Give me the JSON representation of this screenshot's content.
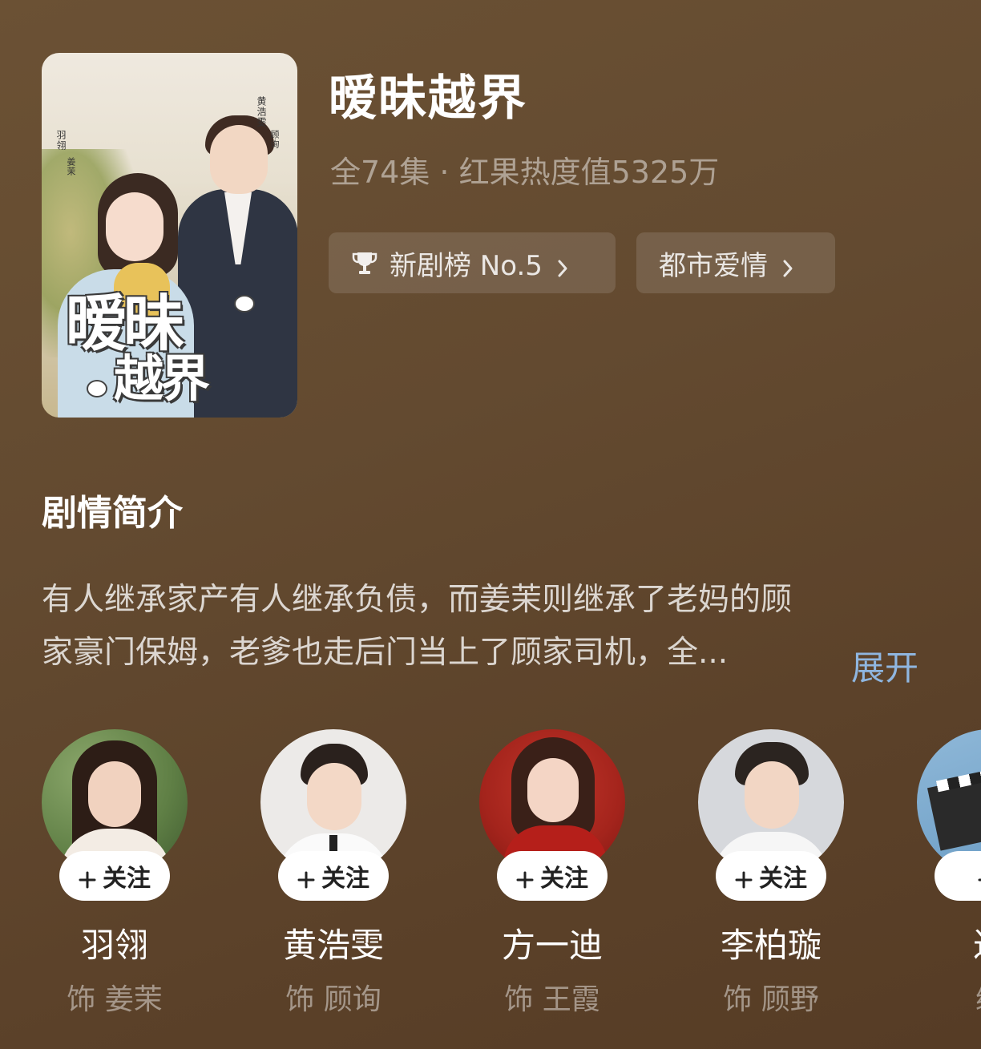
{
  "poster": {
    "title_line1": "暧昧",
    "title_line2": "越界",
    "credit_right_name": "黄浩雯",
    "credit_right_role": "顾询",
    "credit_left_name": "羽翎",
    "credit_left_role": "姜茉"
  },
  "show": {
    "title": "暧昧越界",
    "meta": "全74集 · 红果热度值5325万",
    "rank_tag": "新剧榜 No.5",
    "genre_tag": "都市爱情"
  },
  "synopsis": {
    "heading": "剧情简介",
    "line1": "有人继承家产有人继承负债，而姜茉则继承了老妈的顾",
    "line2": "家豪门保姆，老爹也走后门当上了顾家司机，全...",
    "expand_label": "展开"
  },
  "cast": [
    {
      "name": "羽翎",
      "role": "饰 姜茉",
      "follow_label": "关注"
    },
    {
      "name": "黄浩雯",
      "role": "饰 顾询",
      "follow_label": "关注"
    },
    {
      "name": "方一迪",
      "role": "饰 王霞",
      "follow_label": "关注"
    },
    {
      "name": "李柏璇",
      "role": "饰 顾野",
      "follow_label": "关注"
    },
    {
      "name": "过",
      "role": "编"
    }
  ],
  "colors": {
    "background": "#634a30",
    "accent_link": "#8fb6e0",
    "follow_button": "#ffffff"
  },
  "icons": [
    "trophy-icon",
    "chevron-right-icon",
    "plus-icon",
    "paw-icon"
  ]
}
